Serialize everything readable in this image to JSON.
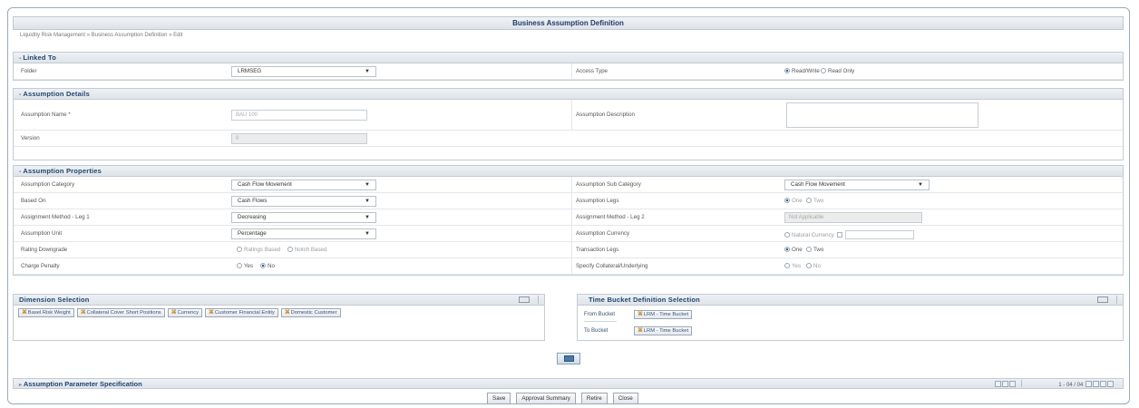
{
  "page_title": "Business Assumption Definition",
  "breadcrumb": "Liquidity Risk Management » Business Assumption Definition » Edit",
  "linked_to": {
    "title": "Linked To",
    "folder_label": "Folder",
    "folder_value": "LRMSEG",
    "access_label": "Access Type",
    "access_options": [
      "Read/Write",
      "Read Only"
    ],
    "access_selected": "Read/Write"
  },
  "details": {
    "title": "Assumption Details",
    "name_label": "Assumption Name *",
    "name_value": "BAU 100",
    "desc_label": "Assumption Description",
    "desc_value": "",
    "version_label": "Version",
    "version_value": "0"
  },
  "properties": {
    "title": "Assumption Properties",
    "category_label": "Assumption Category",
    "category_value": "Cash Flow Movement",
    "subcategory_label": "Assumption Sub Category",
    "subcategory_value": "Cash Flow Movement",
    "based_on_label": "Based On",
    "based_on_value": "Cash Flows",
    "legs_label": "Assumption Legs",
    "legs_options": [
      "One",
      "Two"
    ],
    "method1_label": "Assignment Method - Leg 1",
    "method1_value": "Decreasing",
    "method2_label": "Assignment Method - Leg 2",
    "method2_value": "Not Applicable",
    "unit_label": "Assumption Unit",
    "unit_value": "Percentage",
    "currency_label": "Assumption Currency",
    "currency_option": "Natural Currency",
    "rating_label": "Rating Downgrade",
    "rating_options": [
      "Ratings Based",
      "Notch Based"
    ],
    "txn_legs_label": "Transaction Legs",
    "txn_legs_options": [
      "One",
      "Two"
    ],
    "penalty_label": "Charge Penalty",
    "penalty_options": [
      "Yes",
      "No"
    ],
    "collateral_label": "Specify Collateral/Underlying",
    "collateral_options": [
      "Yes",
      "No"
    ]
  },
  "dimension": {
    "title": "Dimension Selection",
    "chips": [
      "Basel Risk Weight",
      "Collateral Cover Short Positions",
      "Currency",
      "Customer Financial Entity",
      "Domestic Customer"
    ]
  },
  "time_bucket": {
    "title": "Time Bucket Definition Selection",
    "from_label": "From Bucket",
    "from_value": "LRM - Time Bucket",
    "to_label": "To Bucket",
    "to_value": "LRM - Time Bucket"
  },
  "param_spec": {
    "title": "Assumption Parameter Specification",
    "pager_text": "1 - 04 / 04"
  },
  "actions": [
    "Save",
    "Approval Summary",
    "Retire",
    "Close"
  ],
  "colors": {
    "header_text": "#20456f",
    "accent": "#2c5fa0"
  }
}
